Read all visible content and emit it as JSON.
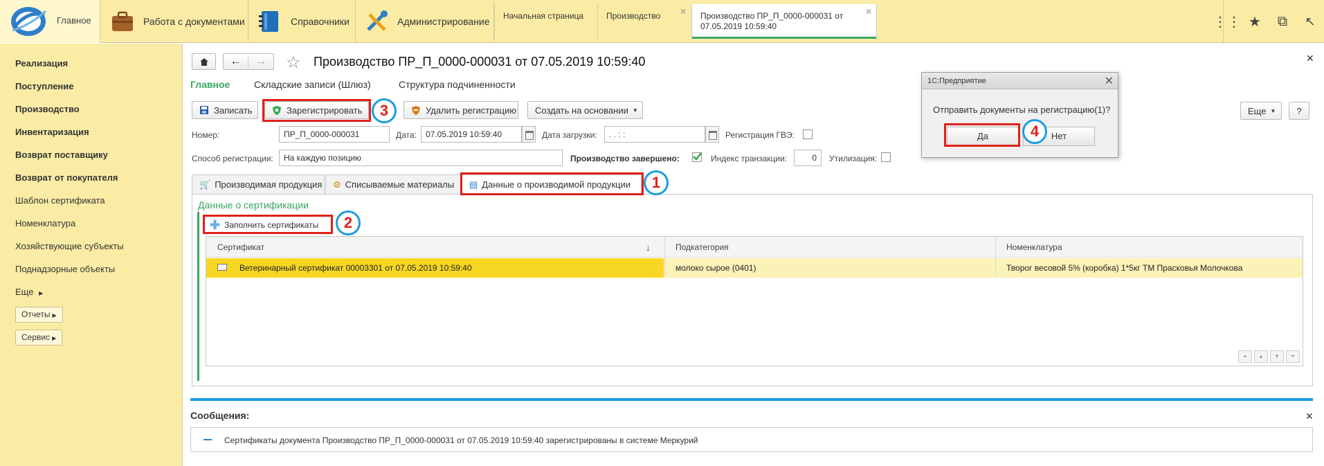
{
  "topbar": {
    "home_label": "Главное",
    "sections": [
      {
        "label": "Работа с документами",
        "icon": "briefcase-icon"
      },
      {
        "label": "Справочники",
        "icon": "book-icon"
      },
      {
        "label": "Администрирование",
        "icon": "tools-icon"
      }
    ],
    "tabs": [
      {
        "label": "Начальная страница"
      },
      {
        "label": "Производство"
      },
      {
        "label_line1": "Производство ПР_П_0000-000031 от",
        "label_line2": "07.05.2019 10:59:40"
      }
    ]
  },
  "sidebar": {
    "items": [
      {
        "label": "Реализация"
      },
      {
        "label": "Поступление"
      },
      {
        "label": "Производство"
      },
      {
        "label": "Инвентаризация"
      },
      {
        "label": "Возврат поставщику"
      },
      {
        "label": "Возврат от покупателя"
      },
      {
        "label": "Шаблон сертификата"
      },
      {
        "label": "Номенклатура"
      },
      {
        "label": "Хозяйствующие субъекты"
      },
      {
        "label": "Поднадзорные объекты"
      },
      {
        "label": "Еще"
      }
    ],
    "reports_label": "Отчеты",
    "service_label": "Сервис"
  },
  "document": {
    "title": "Производство ПР_П_0000-000031 от 07.05.2019 10:59:40",
    "nav_tabs": [
      "Главное",
      "Складские записи (Шлюз)",
      "Структура подчиненности"
    ],
    "toolbar": {
      "save": "Записать",
      "register": "Зарегистрировать",
      "unregister": "Удалить регистрацию",
      "create_based": "Создать на основании",
      "more": "Еще",
      "help": "?"
    },
    "fields": {
      "number_label": "Номер:",
      "number_value": "ПР_П_0000-000031",
      "date_label": "Дата:",
      "date_value": "07.05.2019 10:59:40",
      "load_date_label": "Дата загрузки:",
      "load_date_value": " .  .      :  :",
      "gve_label": "Регистрация ГВЭ:",
      "method_label": "Способ регистрации:",
      "method_value": "На каждую позицию",
      "completed_label": "Производство завершено:",
      "tx_index_label": "Индекс транзакции:",
      "tx_index_value": "0",
      "utilization_label": "Утилизация:"
    },
    "form_tabs": [
      "Производимая продукция",
      "Списываемые материалы",
      "Данные о производимой продукции"
    ],
    "cert_section_title": "Данные о сертификации",
    "fill_certs": "Заполнить сертификаты",
    "grid": {
      "columns": [
        "Сертификат",
        "Подкатегория",
        "Номенклатура"
      ],
      "rows": [
        {
          "certificate": "Ветеринарный сертификат 00003301 от 07.05.2019 10:59:40",
          "subcategory": "молоко сырое (0401)",
          "nomenclature": "Творог весовой 5%  (коробка) 1*5кг ТМ Прасковья Молочкова"
        }
      ]
    }
  },
  "dialog": {
    "title": "1С:Предприятие",
    "message": "Отправить документы на регистрацию(1)?",
    "yes": "Да",
    "no": "Нет"
  },
  "messages": {
    "title": "Сообщения:",
    "text": "Сертификаты документа Производство ПР_П_0000-000031 от 07.05.2019 10:59:40 зарегистрированы в системе Меркурий"
  },
  "annotations": [
    "1",
    "2",
    "3",
    "4"
  ],
  "colors": {
    "accent_green": "#3aa560",
    "highlight_red": "#e0201a",
    "badge_blue": "#1a9de0",
    "selected_row": "#f7d722",
    "panel_yellow": "#fbeca5"
  }
}
